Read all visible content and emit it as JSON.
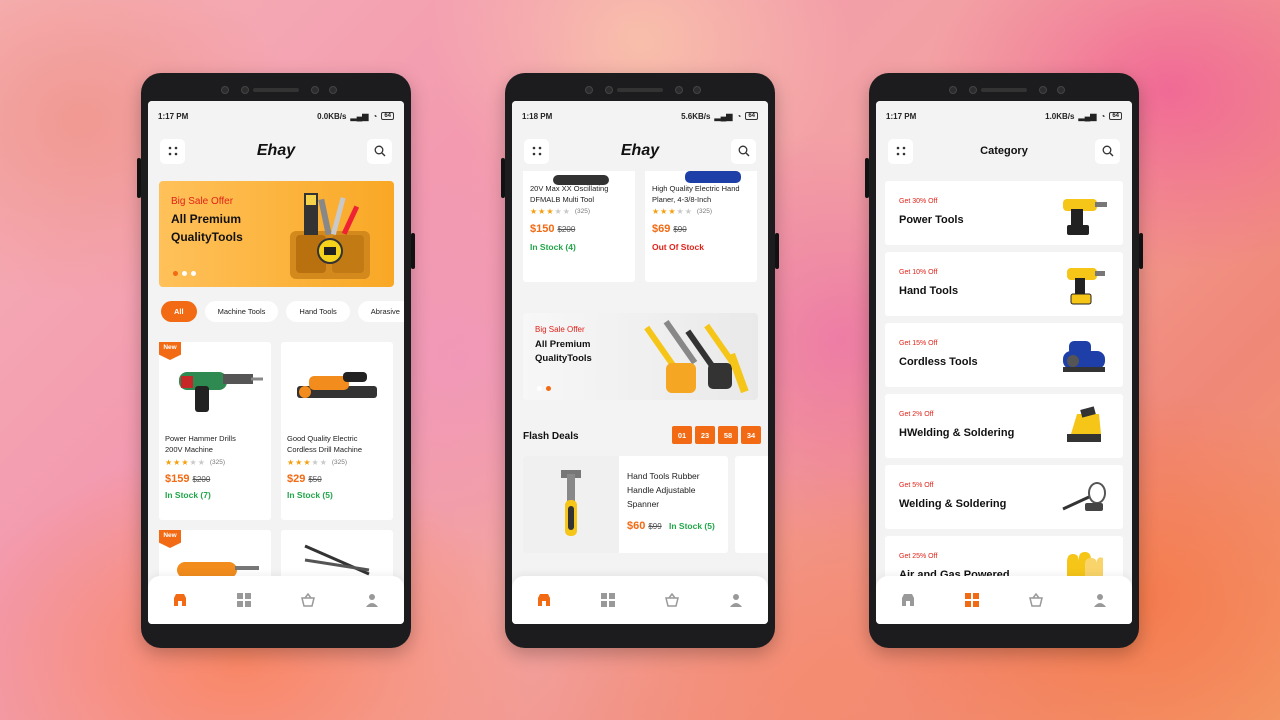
{
  "colors": {
    "accent": "#f26a13",
    "sale_red": "#e0231a",
    "in_stock": "#22a64a"
  },
  "phone1": {
    "status": {
      "time": "1:17 PM",
      "speed": "0.0KB/s",
      "battery": "64"
    },
    "header": {
      "logo": "Ehay",
      "menu_icon": "grid-dots-icon",
      "search_icon": "search-icon"
    },
    "banner": {
      "subtitle": "Big Sale Offer",
      "title_line1": "All Premium",
      "title_line2": "QualityTools",
      "slide": 1,
      "slides": 3
    },
    "chips": [
      "All",
      "Machine Tools",
      "Hand Tools",
      "Abrasive"
    ],
    "products": [
      {
        "badge": "New",
        "name_line1": "Power Hammer Drills",
        "name_line2": "200V Machine",
        "rating": 3,
        "reviews": "(325)",
        "price": "$159",
        "old_price": "$200",
        "stock": "In Stock (7)"
      },
      {
        "badge": "",
        "name_line1": "Good Quality Electric",
        "name_line2": "Cordless Drill Machine",
        "rating": 3,
        "reviews": "(325)",
        "price": "$29",
        "old_price": "$50",
        "stock": "In Stock (5)"
      },
      {
        "badge": "New"
      }
    ],
    "nav": [
      "store-icon",
      "grid-icon",
      "basket-icon",
      "user-icon"
    ],
    "nav_active": 0
  },
  "phone2": {
    "status": {
      "time": "1:18 PM",
      "speed": "5.6KB/s",
      "battery": "64"
    },
    "header": {
      "logo": "Ehay"
    },
    "products": [
      {
        "name_line1": "20V Max XX Oscillating",
        "name_line2": "DFMALB Multi Tool",
        "rating": 3,
        "reviews": "(325)",
        "price": "$150",
        "old_price": "$200",
        "stock": "In Stock (4)"
      },
      {
        "name_line1": "High Quality Electric Hand",
        "name_line2": "Planer, 4-3/8-Inch",
        "rating": 3,
        "reviews": "(325)",
        "price": "$69",
        "old_price": "$90",
        "stock": "Out Of Stock"
      }
    ],
    "banner": {
      "subtitle": "Big Sale Offer",
      "title_line1": "All Premium",
      "title_line2": "QualityTools",
      "slide": 2,
      "slides": 2
    },
    "flash": {
      "title": "Flash Deals",
      "timer": [
        "01",
        "23",
        "58",
        "34"
      ],
      "item": {
        "name_line1": "Hand Tools Rubber",
        "name_line2": "Handle Adjustable",
        "name_line3": "Spanner",
        "price": "$60",
        "old_price": "$99",
        "stock": "In Stock (5)"
      }
    },
    "nav_active": 0
  },
  "phone3": {
    "status": {
      "time": "1:17 PM",
      "speed": "1.0KB/s",
      "battery": "64"
    },
    "header": {
      "title": "Category"
    },
    "categories": [
      {
        "offer": "Get 30% Off",
        "name": "Power Tools",
        "icon": "power-drill-icon"
      },
      {
        "offer": "Get 10% Off",
        "name": "Hand Tools",
        "icon": "cordless-drill-icon"
      },
      {
        "offer": "Get 15% Off",
        "name": "Cordless Tools",
        "icon": "belt-sander-icon"
      },
      {
        "offer": "Get 2% Off",
        "name": "HWelding & Soldering",
        "icon": "staple-gun-icon"
      },
      {
        "offer": "Get 5% Off",
        "name": "Welding & Soldering",
        "icon": "soldering-iron-icon"
      },
      {
        "offer": "Get 25% Off",
        "name": "Air and Gas Powered",
        "icon": "gloves-icon"
      }
    ],
    "nav_active": 1
  }
}
